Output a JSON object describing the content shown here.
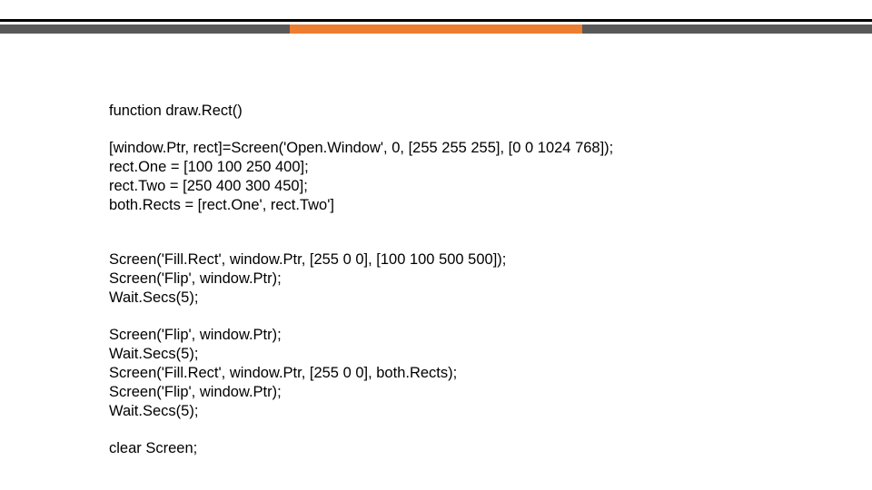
{
  "code": {
    "p1": {
      "l1": "function draw.Rect()"
    },
    "p2": {
      "l1": "[window.Ptr, rect]=Screen('Open.Window', 0, [255 255 255], [0 0 1024 768]);",
      "l2": "rect.One = [100 100 250 400];",
      "l3": "rect.Two = [250 400 300 450];",
      "l4": "both.Rects = [rect.One', rect.Two']"
    },
    "p3": {
      "l1": "Screen('Fill.Rect', window.Ptr, [255 0 0], [100 100 500 500]);",
      "l2": "Screen('Flip', window.Ptr);",
      "l3": "Wait.Secs(5);"
    },
    "p4": {
      "l1": "Screen('Flip', window.Ptr);",
      "l2": "Wait.Secs(5);",
      "l3": "Screen('Fill.Rect', window.Ptr, [255 0 0], both.Rects);",
      "l4": "Screen('Flip', window.Ptr);",
      "l5": "Wait.Secs(5);"
    },
    "p5": {
      "l1": "clear Screen;"
    }
  }
}
